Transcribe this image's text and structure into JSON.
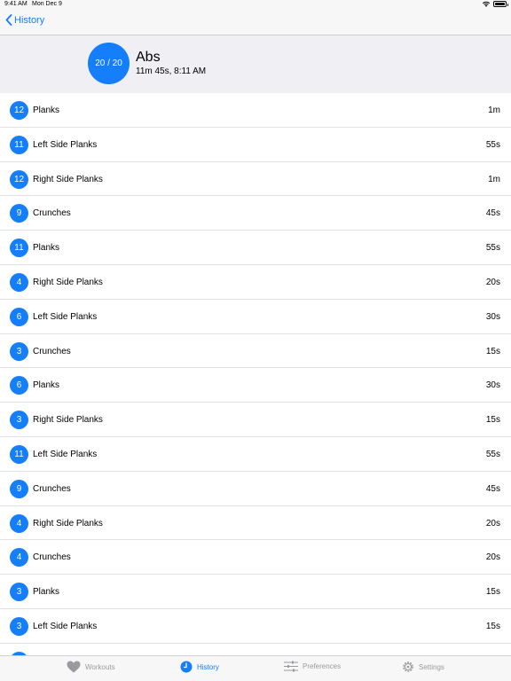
{
  "status_bar": {
    "time": "9:41 AM",
    "date": "Mon Dec 9"
  },
  "nav": {
    "back_label": "History"
  },
  "summary": {
    "progress": "20 / 20",
    "title": "Abs",
    "meta": "11m 45s, 8:11 AM"
  },
  "exercises": [
    {
      "reps": "12",
      "name": "Planks",
      "duration": "1m"
    },
    {
      "reps": "11",
      "name": "Left Side Planks",
      "duration": "55s"
    },
    {
      "reps": "12",
      "name": "Right Side Planks",
      "duration": "1m"
    },
    {
      "reps": "9",
      "name": "Crunches",
      "duration": "45s"
    },
    {
      "reps": "11",
      "name": "Planks",
      "duration": "55s"
    },
    {
      "reps": "4",
      "name": "Right Side Planks",
      "duration": "20s"
    },
    {
      "reps": "6",
      "name": "Left Side Planks",
      "duration": "30s"
    },
    {
      "reps": "3",
      "name": "Crunches",
      "duration": "15s"
    },
    {
      "reps": "6",
      "name": "Planks",
      "duration": "30s"
    },
    {
      "reps": "3",
      "name": "Right Side Planks",
      "duration": "15s"
    },
    {
      "reps": "11",
      "name": "Left Side Planks",
      "duration": "55s"
    },
    {
      "reps": "9",
      "name": "Crunches",
      "duration": "45s"
    },
    {
      "reps": "4",
      "name": "Right Side Planks",
      "duration": "20s"
    },
    {
      "reps": "4",
      "name": "Crunches",
      "duration": "20s"
    },
    {
      "reps": "3",
      "name": "Planks",
      "duration": "15s"
    },
    {
      "reps": "3",
      "name": "Left Side Planks",
      "duration": "15s"
    },
    {
      "reps": "",
      "name": "",
      "duration": ""
    }
  ],
  "tabs": [
    {
      "label": "Workouts",
      "icon": "heart-icon",
      "active": false
    },
    {
      "label": "History",
      "icon": "clock-icon",
      "active": true
    },
    {
      "label": "Preferences",
      "icon": "sliders-icon",
      "active": false
    },
    {
      "label": "Settings",
      "icon": "gear-icon",
      "active": false
    }
  ],
  "colors": {
    "accent": "#147efb",
    "inactive": "#9a9a9f",
    "summary_bg": "#efeff4",
    "bar_bg": "#f7f7f7"
  }
}
